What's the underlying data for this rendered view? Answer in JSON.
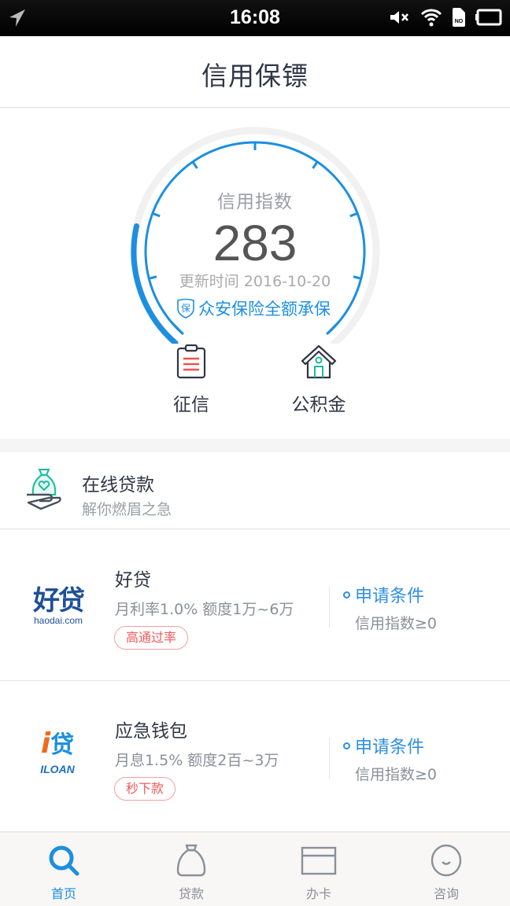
{
  "status_bar": {
    "time": "16:08",
    "icons": [
      "location-arrow-icon",
      "mute-icon",
      "wifi-icon",
      "no-sim-icon",
      "battery-icon"
    ]
  },
  "header": {
    "title": "信用保镖"
  },
  "gauge": {
    "label": "信用指数",
    "score": "283",
    "progress_fraction": 0.2,
    "update_text": "更新时间 2016-10-20",
    "insurance_badge": "保",
    "insurance_text": "众安保险全额承保",
    "accent_color": "#1c8fe0"
  },
  "quick_actions": [
    {
      "label": "征信",
      "icon": "clipboard-icon"
    },
    {
      "label": "公积金",
      "icon": "house-icon"
    }
  ],
  "online_loan": {
    "title": "在线贷款",
    "subtitle": "解你燃眉之急",
    "icon": "money-bag-hand-icon"
  },
  "loans": [
    {
      "logo_main": "好贷",
      "logo_sub": "haodai.com",
      "name": "好贷",
      "desc": "月利率1.0% 额度1万~6万",
      "tag": "高通过率",
      "cond_label": "申请条件",
      "cond_value": "信用指数≥0"
    },
    {
      "logo_main": "贷",
      "logo_i": "i",
      "logo_sub": "ILOAN",
      "name": "应急钱包",
      "desc": "月息1.5% 额度2百~3万",
      "tag": "秒下款",
      "cond_label": "申请条件",
      "cond_value": "信用指数≥0"
    }
  ],
  "tabbar": [
    {
      "label": "首页",
      "icon": "search-icon",
      "active": true
    },
    {
      "label": "贷款",
      "icon": "money-bag-icon",
      "active": false
    },
    {
      "label": "办卡",
      "icon": "card-icon",
      "active": false
    },
    {
      "label": "咨询",
      "icon": "smile-icon",
      "active": false
    }
  ]
}
